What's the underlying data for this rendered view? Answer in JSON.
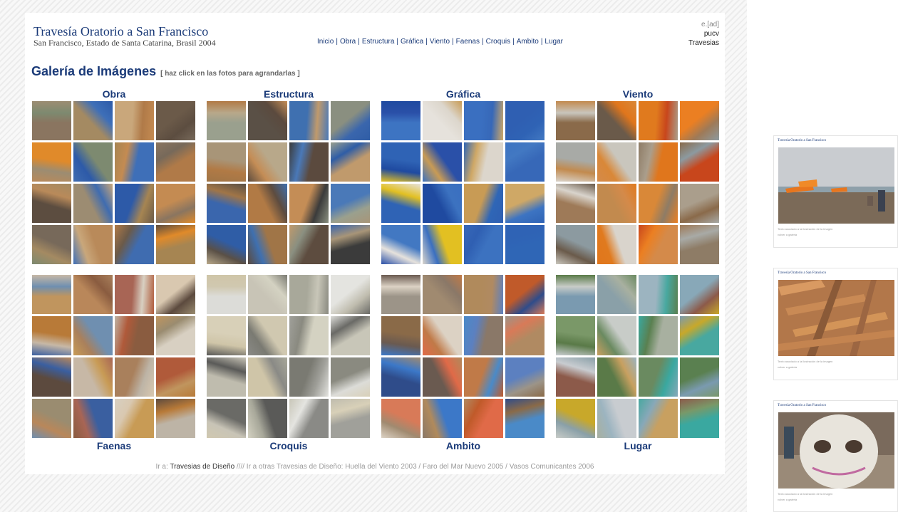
{
  "header": {
    "site_title": "Travesía Oratorio a San Francisco",
    "subtitle": "San Francisco, Estado de Santa Catarina, Brasil 2004",
    "nav": [
      "Inicio",
      "Obra",
      "Estructura",
      "Gráfica",
      "Viento",
      "Faenas",
      "Croquis",
      "Ambito",
      "Lugar"
    ],
    "right_line1": "e.[ad]",
    "right_line2": "pucv",
    "right_line3": "Travesias"
  },
  "gallery": {
    "title": "Galería de Imágenes",
    "subtitle": "[ haz click en las fotos para agrandarlas ]",
    "top_labels": [
      "Obra",
      "Estructura",
      "Gráfica",
      "Viento"
    ],
    "bottom_labels": [
      "Faenas",
      "Croquis",
      "Ambito",
      "Lugar"
    ],
    "palettes": [
      [
        "#8a7560",
        "#a48a62",
        "#c9a77b",
        "#6b5a49",
        "#e08a2a",
        "#7d8a70",
        "#3e6fb8",
        "#b07a48",
        "#5c4d40",
        "#9c8c72",
        "#2d5aa8",
        "#c48b52",
        "#77695a",
        "#b98a5a",
        "#3f6cb0",
        "#a68552"
      ],
      [
        "#9aa08e",
        "#5a5046",
        "#3f70b0",
        "#8a8f80",
        "#a89578",
        "#b8a88a",
        "#5b4a3e",
        "#c09a6c",
        "#3a66ad",
        "#b17a45",
        "#c48d56",
        "#4a79b8",
        "#2f5da6",
        "#a07547",
        "#5d4c3f",
        "#3b3b3b"
      ],
      [
        "#3d74c2",
        "#e6e2dc",
        "#3a6fc0",
        "#2f5fb2",
        "#2f63b5",
        "#2a50a8",
        "#dcd6cc",
        "#3768b8",
        "#2f63b5",
        "#1f4aa0",
        "#c89b55",
        "#cfa866",
        "#4278c2",
        "#e2c022",
        "#3c72c0",
        "#2f66b6"
      ],
      [
        "#8a6a4a",
        "#6a5a4a",
        "#e07a1e",
        "#eb7f22",
        "#a8aaa6",
        "#c9c6bd",
        "#e0761c",
        "#c8461c",
        "#9e7a58",
        "#c28a4e",
        "#d98838",
        "#aa9e8c",
        "#8c9aa0",
        "#d9d4cc",
        "#d48a4a",
        "#8e7c66"
      ],
      [
        "#c0955e",
        "#b9875a",
        "#a86555",
        "#d9c8b0",
        "#b87a38",
        "#6f8fb0",
        "#8a5c40",
        "#d8d0c2",
        "#5c4a3e",
        "#c7b8a6",
        "#a9805c",
        "#b05a3a",
        "#9a8c70",
        "#3a5fa0",
        "#c89b55",
        "#bdb4a6"
      ],
      [
        "#dcdcd8",
        "#c8c4b6",
        "#a8a89a",
        "#e4e4e0",
        "#d8d0b8",
        "#d0c8b0",
        "#d4d2c2",
        "#c8c6b8",
        "#bfbcae",
        "#cfc5a8",
        "#7a7a72",
        "#8a8a80",
        "#6a6a66",
        "#5a5a58",
        "#8a8a86",
        "#a0a09a"
      ],
      [
        "#9c9488",
        "#a08a70",
        "#b08a5c",
        "#c05a2a",
        "#8a6a48",
        "#dcd2c4",
        "#8a7868",
        "#b08a62",
        "#2f4c8a",
        "#6a5a50",
        "#c07a48",
        "#5c80c0",
        "#d87a58",
        "#3c78c8",
        "#e06a48",
        "#4a8ac8"
      ],
      [
        "#7a9ab0",
        "#8aa0a8",
        "#9cb4c0",
        "#88a8b8",
        "#7a9868",
        "#c8ccc8",
        "#a8b0a0",
        "#48a8a0",
        "#8c5a4a",
        "#5a7a48",
        "#6a8a60",
        "#5a8050",
        "#c8a82a",
        "#c8ccd0",
        "#c8a060",
        "#3aa8a0"
      ]
    ]
  },
  "footer": {
    "prefix": "Ir a:",
    "link1": "Travesias de Diseño",
    "sep": " //// ",
    "rest": "Ir a otras Travesias de Diseño: Huella del Viento 2003 / Faro del Mar Nuevo 2005 / Vasos Comunicantes 2006"
  },
  "previews": [
    {
      "title": "Travesía Oratorio a San Francisco",
      "caption": "Texto asociado a la ilustración de la imagen",
      "back": "volver a galeria"
    },
    {
      "title": "Travesía Oratorio a San Francisco",
      "caption": "Texto asociado a la ilustración de la imagen",
      "back": "volver a galeria"
    },
    {
      "title": "Travesía Oratorio a San Francisco",
      "caption": "Texto asociado a la ilustración de la imagen",
      "back": "volver a galeria"
    }
  ]
}
